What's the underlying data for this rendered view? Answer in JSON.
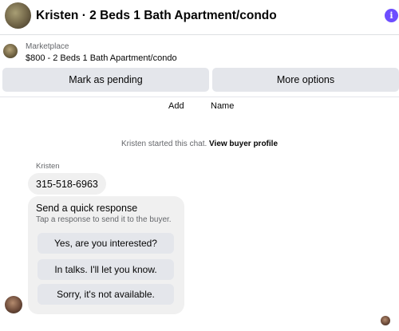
{
  "header": {
    "title": "Kristen · 2 Beds 1 Bath Apartment/condo",
    "info_icon": "i"
  },
  "listing": {
    "source": "Marketplace",
    "title": "$800 - 2 Beds 1 Bath Apartment/condo"
  },
  "actions": {
    "mark_pending": "Mark as pending",
    "more_options": "More options"
  },
  "toolbar": {
    "add": "Add",
    "name": "Name"
  },
  "system": {
    "started": "Kristen started this chat.",
    "view_profile": "View buyer profile"
  },
  "message": {
    "sender": "Kristen",
    "text": "315-518-6963"
  },
  "quick_response": {
    "title": "Send a quick response",
    "subtitle": "Tap a response to send it to the buyer.",
    "options": [
      "Yes, are you interested?",
      "In talks. I'll let you know.",
      "Sorry, it's not available."
    ]
  },
  "colors": {
    "accent": "#6d4dff",
    "button_bg": "#e4e6eb",
    "bubble_bg": "#f0f0f0"
  }
}
